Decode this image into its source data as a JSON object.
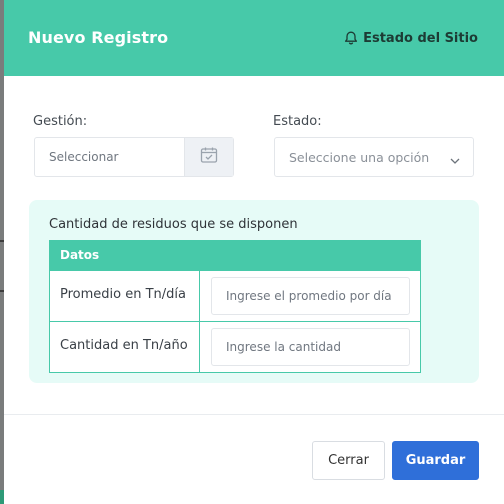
{
  "modal": {
    "title": "Nuevo Registro",
    "site_status_label": "Estado del Sitio",
    "site_status_icon": "bell-icon"
  },
  "form": {
    "gestion": {
      "label": "Gestión:",
      "placeholder": "Seleccionar",
      "icon": "calendar-icon"
    },
    "estado": {
      "label": "Estado:",
      "placeholder": "Seleccione una opción",
      "icon": "chevron-down-icon"
    }
  },
  "residues": {
    "title": "Cantidad de residuos que se disponen",
    "table_header": "Datos",
    "rows": [
      {
        "label": "Promedio en Tn/día",
        "placeholder": "Ingrese el promedio por día"
      },
      {
        "label": "Cantidad en Tn/año",
        "placeholder": "Ingrese la cantidad"
      }
    ]
  },
  "footer": {
    "close_label": "Cerrar",
    "save_label": "Guardar"
  },
  "colors": {
    "header": "#47c9a9",
    "panel_bg": "#e6fbf7",
    "primary_button": "#2f6fd9"
  }
}
